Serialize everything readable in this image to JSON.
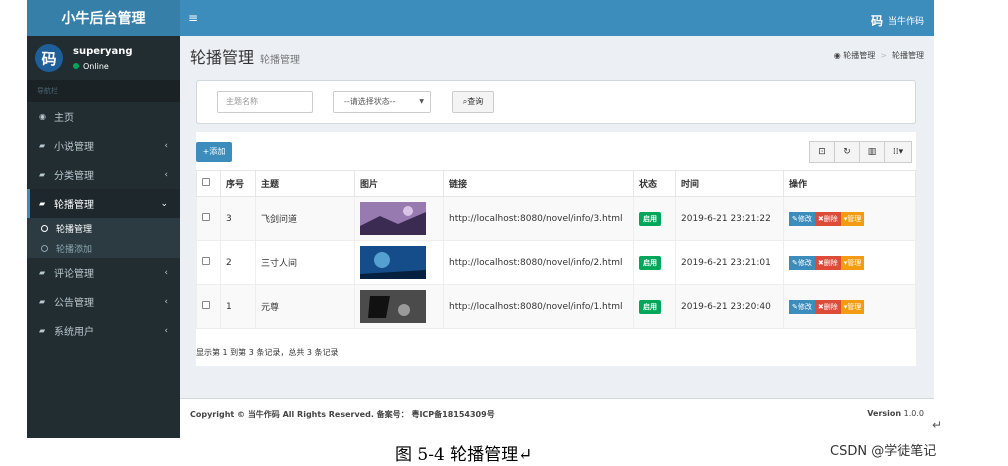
{
  "app": {
    "logo": "小牛后台管理",
    "top_user": "当牛作码",
    "avatar_char": "码"
  },
  "topbar": {
    "menu_icon": "≡"
  },
  "user": {
    "name": "superyang",
    "status": "Online"
  },
  "nav": {
    "header": "导航栏",
    "items": [
      {
        "label": "主页",
        "chevron": ""
      },
      {
        "label": "小说管理",
        "chevron": "‹"
      },
      {
        "label": "分类管理",
        "chevron": "‹"
      },
      {
        "label": "轮播管理",
        "chevron": "⌄"
      },
      {
        "label": "评论管理",
        "chevron": "‹"
      },
      {
        "label": "公告管理",
        "chevron": "‹"
      },
      {
        "label": "系统用户",
        "chevron": "‹"
      }
    ],
    "sub_items": [
      {
        "label": "轮播管理"
      },
      {
        "label": "轮播添加"
      }
    ]
  },
  "page": {
    "title": "轮播管理",
    "subtitle": "轮播管理"
  },
  "breadcrumb": {
    "home": "轮播管理",
    "current": "轮播管理"
  },
  "search": {
    "title_placeholder": "主题名称",
    "status_select": "--请选择状态--",
    "query_label": "查询"
  },
  "toolbar": {
    "add_label": "添加"
  },
  "table": {
    "headers": [
      "序号",
      "主题",
      "图片",
      "链接",
      "状态",
      "时间",
      "操作"
    ],
    "rows": [
      {
        "no": "3",
        "title": "飞剑问道",
        "link": "http://localhost:8080/novel/info/3.html",
        "status": "启用",
        "time": "2019-6-21 23:21:22"
      },
      {
        "no": "2",
        "title": "三寸人间",
        "link": "http://localhost:8080/novel/info/2.html",
        "status": "启用",
        "time": "2019-6-21 23:21:01"
      },
      {
        "no": "1",
        "title": "元尊",
        "link": "http://localhost:8080/novel/info/1.html",
        "status": "启用",
        "time": "2019-6-21 23:20:40"
      }
    ],
    "actions": {
      "edit": "修改",
      "delete": "删除",
      "manage": "管理"
    }
  },
  "pager": {
    "info": "显示第 1 到第 3 条记录，总共 3 条记录"
  },
  "footer": {
    "copyright": "Copyright © 当牛作码 All Rights Reserved. 备案号： 粤ICP备18154309号",
    "version_label": "Version",
    "version_number": "1.0.0"
  },
  "doc": {
    "caption": "图 5-4 轮播管理↵",
    "return_mark": "↵",
    "watermark": "CSDN @学徒笔记"
  },
  "colors": {
    "primary": "#3c8dbc",
    "sidebar": "#222d32",
    "success": "#00a65a",
    "danger": "#dd4b39",
    "warning": "#f39c12"
  }
}
